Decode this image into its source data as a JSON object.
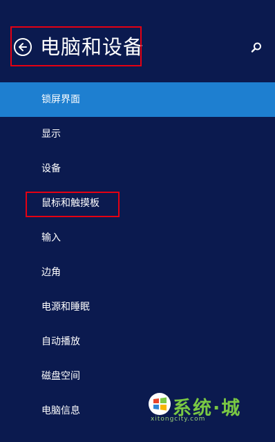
{
  "header": {
    "title": "电脑和设备"
  },
  "menu": [
    {
      "label": "锁屏界面",
      "active": true
    },
    {
      "label": "显示",
      "active": false
    },
    {
      "label": "设备",
      "active": false
    },
    {
      "label": "鼠标和触摸板",
      "active": false
    },
    {
      "label": "输入",
      "active": false
    },
    {
      "label": "边角",
      "active": false
    },
    {
      "label": "电源和睡眠",
      "active": false
    },
    {
      "label": "自动播放",
      "active": false
    },
    {
      "label": "磁盘空间",
      "active": false
    },
    {
      "label": "电脑信息",
      "active": false
    }
  ],
  "watermark": {
    "name": "系统·城",
    "url": "xitongcity.com"
  },
  "colors": {
    "background": "#0b1a4f",
    "selected": "#1e7fd0",
    "highlight_box": "#e60012",
    "watermark": "#7ac943"
  },
  "icons": {
    "back": "back-arrow-circle-icon",
    "search": "search-icon"
  }
}
